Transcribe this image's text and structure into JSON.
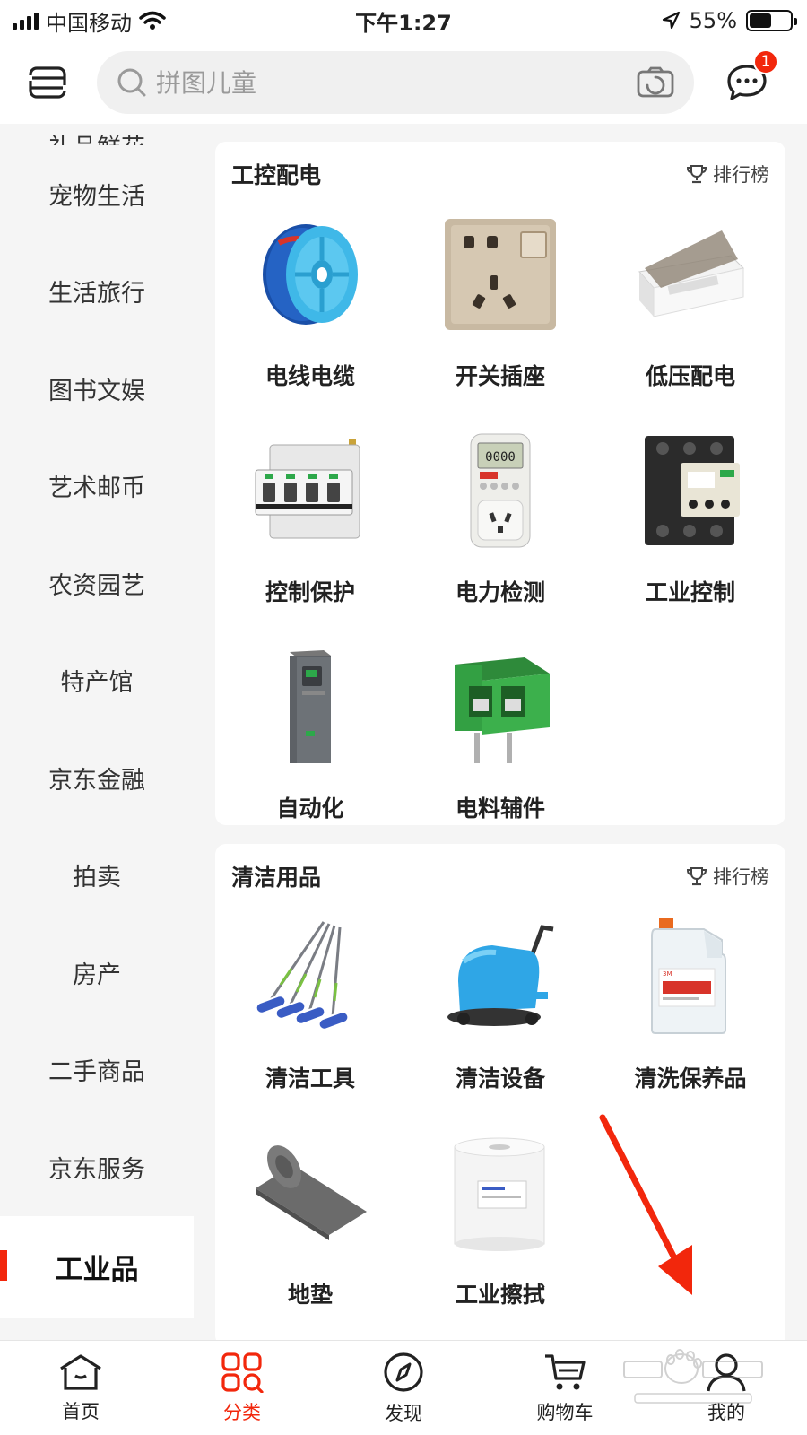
{
  "status_bar": {
    "carrier": "中国移动",
    "time": "下午1:27",
    "battery": "55%",
    "battery_level": 0.55
  },
  "header": {
    "search_placeholder": "拼图儿童",
    "message_badge": "1"
  },
  "sidebar": {
    "partial_top": "礼品鲜花",
    "items": [
      "宠物生活",
      "生活旅行",
      "图书文娱",
      "艺术邮币",
      "农资园艺",
      "特产馆",
      "京东金融",
      "拍卖",
      "房产",
      "二手商品",
      "京东服务"
    ],
    "active": "工业品"
  },
  "sections": [
    {
      "title": "工控配电",
      "rank_label": "排行榜",
      "items": [
        {
          "label": "电线电缆",
          "icon": "cable-reel-icon"
        },
        {
          "label": "开关插座",
          "icon": "wall-socket-icon"
        },
        {
          "label": "低压配电",
          "icon": "distribution-box-icon"
        },
        {
          "label": "控制保护",
          "icon": "circuit-breaker-icon"
        },
        {
          "label": "电力检测",
          "icon": "power-meter-icon"
        },
        {
          "label": "工业控制",
          "icon": "contactor-icon"
        },
        {
          "label": "自动化",
          "icon": "inverter-drive-icon"
        },
        {
          "label": "电料辅件",
          "icon": "terminal-block-icon"
        }
      ]
    },
    {
      "title": "清洁用品",
      "rank_label": "排行榜",
      "items": [
        {
          "label": "清洁工具",
          "icon": "flat-mop-icon"
        },
        {
          "label": "清洁设备",
          "icon": "floor-scrubber-icon"
        },
        {
          "label": "清洗保养品",
          "icon": "cleaner-jug-icon"
        },
        {
          "label": "地垫",
          "icon": "floor-mat-icon"
        },
        {
          "label": "工业擦拭",
          "icon": "wiper-roll-icon"
        }
      ]
    }
  ],
  "tabbar": {
    "tabs": [
      "首页",
      "分类",
      "发现",
      "购物车",
      "我的"
    ],
    "active": "分类"
  },
  "colors": {
    "accent": "#f2270c",
    "sidebar_bg": "#f5f5f5"
  }
}
